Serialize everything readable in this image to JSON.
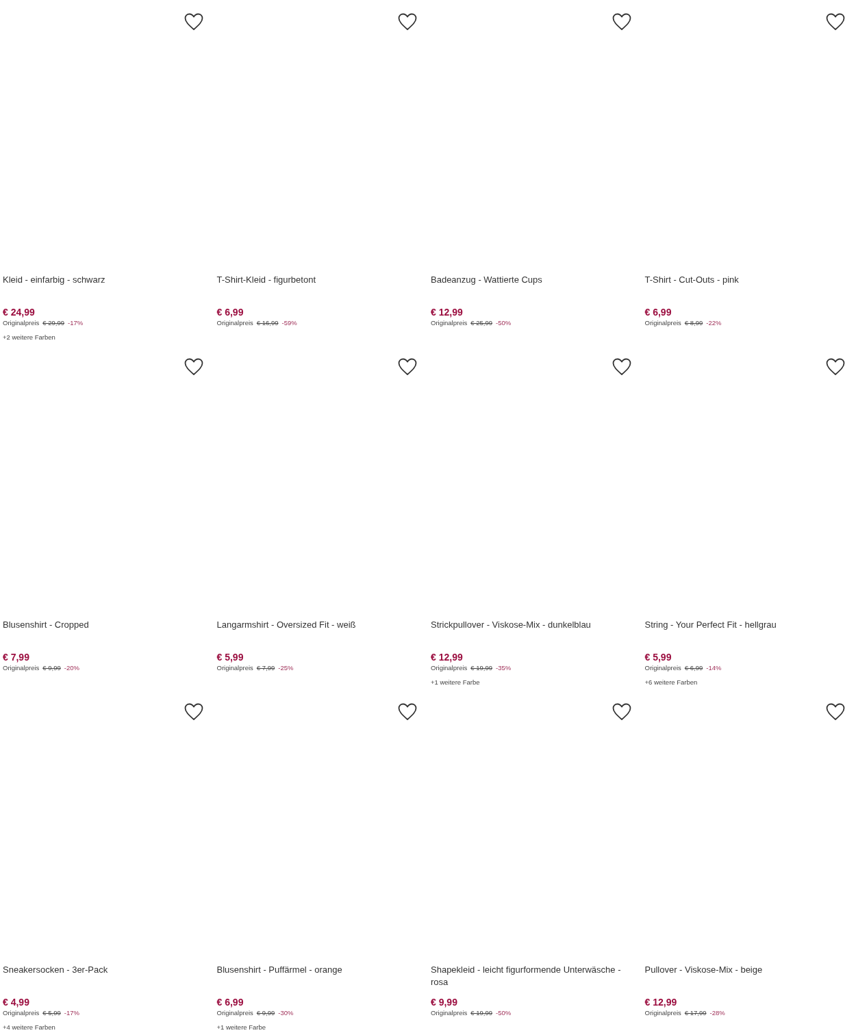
{
  "products": [
    {
      "title": "Kleid - einfarbig - schwarz",
      "price": "€ 24,99",
      "original_label": "Originalpreis",
      "original_price": "€ 29,99",
      "discount": "-17%",
      "more_colors": "+2 weitere Farben"
    },
    {
      "title": "T-Shirt-Kleid - figurbetont",
      "price": "€ 6,99",
      "original_label": "Originalpreis",
      "original_price": "€ 16,99",
      "discount": "-59%"
    },
    {
      "title": "Badeanzug - Wattierte Cups",
      "price": "€ 12,99",
      "original_label": "Originalpreis",
      "original_price": "€ 25,99",
      "discount": "-50%"
    },
    {
      "title": "T-Shirt - Cut-Outs - pink",
      "price": "€ 6,99",
      "original_label": "Originalpreis",
      "original_price": "€ 8,99",
      "discount": "-22%"
    },
    {
      "title": "Blusenshirt - Cropped",
      "price": "€ 7,99",
      "original_label": "Originalpreis",
      "original_price": "€ 9,99",
      "discount": "-20%"
    },
    {
      "title": "Langarmshirt - Oversized Fit - weiß",
      "price": "€ 5,99",
      "original_label": "Originalpreis",
      "original_price": "€ 7,99",
      "discount": "-25%"
    },
    {
      "title": "Strickpullover - Viskose-Mix - dunkelblau",
      "price": "€ 12,99",
      "original_label": "Originalpreis",
      "original_price": "€ 19,99",
      "discount": "-35%",
      "more_colors": "+1 weitere Farbe"
    },
    {
      "title": "String - Your Perfect Fit - hellgrau",
      "price": "€ 5,99",
      "original_label": "Originalpreis",
      "original_price": "€ 6,99",
      "discount": "-14%",
      "more_colors": "+6 weitere Farben"
    },
    {
      "title": "Sneakersocken - 3er-Pack",
      "price": "€ 4,99",
      "original_label": "Originalpreis",
      "original_price": "€ 5,99",
      "discount": "-17%",
      "more_colors": "+4 weitere Farben"
    },
    {
      "title": "Blusenshirt - Puffärmel - orange",
      "price": "€ 6,99",
      "original_label": "Originalpreis",
      "original_price": "€ 9,99",
      "discount": "-30%",
      "more_colors": "+1 weitere Farbe"
    },
    {
      "title": "Shapekleid - leicht figurformende Unterwäsche - rosa",
      "price": "€ 9,99",
      "original_label": "Originalpreis",
      "original_price": "€ 19,99",
      "discount": "-50%"
    },
    {
      "title": "Pullover - Viskose-Mix - beige",
      "price": "€ 12,99",
      "original_label": "Originalpreis",
      "original_price": "€ 17,99",
      "discount": "-28%"
    }
  ]
}
